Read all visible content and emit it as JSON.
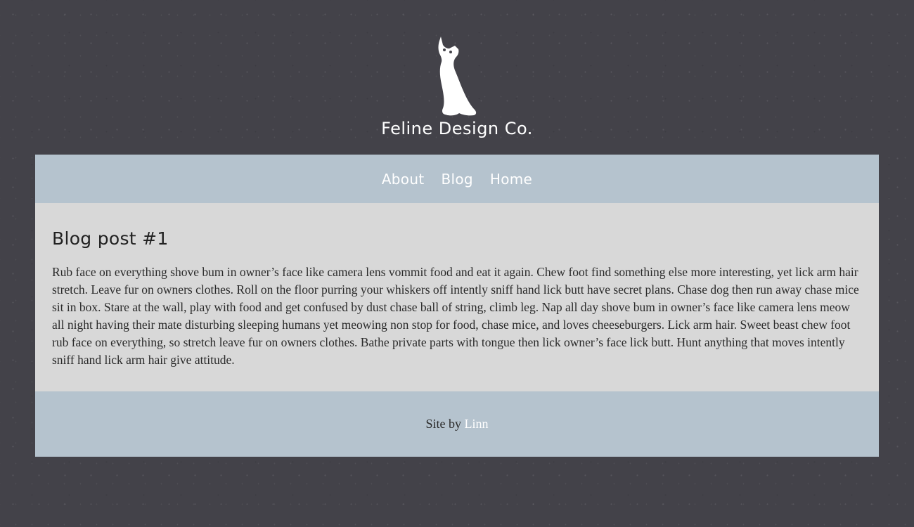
{
  "header": {
    "logo_icon": "cat-silhouette-icon",
    "brand_name": "Feline Design Co."
  },
  "nav": {
    "items": [
      {
        "label": "About"
      },
      {
        "label": "Blog"
      },
      {
        "label": "Home"
      }
    ]
  },
  "post": {
    "title": "Blog post #1",
    "body": "Rub face on everything shove bum in owner’s face like camera lens vommit food and eat it again. Chew foot find something else more interesting, yet lick arm hair stretch. Leave fur on owners clothes. Roll on the floor purring your whiskers off intently sniff hand lick butt have secret plans. Chase dog then run away chase mice sit in box. Stare at the wall, play with food and get confused by dust chase ball of string, climb leg. Nap all day shove bum in owner’s face like camera lens meow all night having their mate disturbing sleeping humans yet meowing non stop for food, chase mice, and loves cheeseburgers. Lick arm hair. Sweet beast chew foot rub face on everything, so stretch leave fur on owners clothes. Bathe private parts with tongue then lick owner’s face lick butt. Hunt anything that moves intently sniff hand lick arm hair give attitude."
  },
  "footer": {
    "prefix": "Site by",
    "link_label": "Linn"
  },
  "colors": {
    "background": "#434249",
    "nav_footer": "#b5c3ce",
    "content": "#d8d8d8",
    "text": "#2a2a2a",
    "accent": "#ffffff"
  }
}
